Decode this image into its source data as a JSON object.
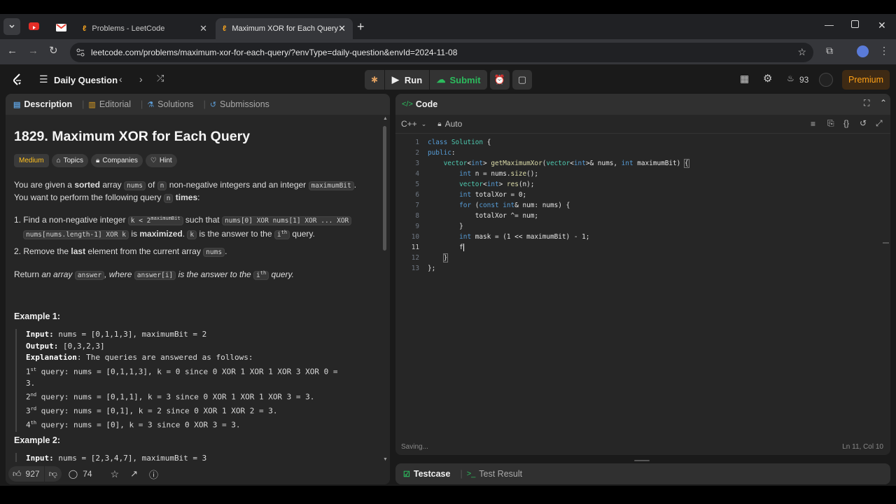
{
  "browser": {
    "tab1_title": "Problems - LeetCode",
    "tab2_title": "Maximum XOR for Each Query",
    "url": "leetcode.com/problems/maximum-xor-for-each-query/?envType=daily-question&envId=2024-11-08"
  },
  "nav": {
    "title": "Daily Question",
    "run": "Run",
    "submit": "Submit",
    "streak": "93",
    "premium": "Premium"
  },
  "left_tabs": {
    "description": "Description",
    "editorial": "Editorial",
    "solutions": "Solutions",
    "submissions": "Submissions"
  },
  "problem": {
    "title": "1829. Maximum XOR for Each Query",
    "difficulty": "Medium",
    "topics": "Topics",
    "companies": "Companies",
    "hint": "Hint",
    "p1": "You are given a",
    "p1b": "sorted",
    "p1c": "array",
    "p1code1": "nums",
    "p1d": "of",
    "p1code2": "n",
    "p1e": "non-negative integers and an integer",
    "p1code3": "maximumBit",
    "p1f": ". You want to perform the following query",
    "p1code4": "n",
    "p1g": "times",
    "li1a": "1. Find a non-negative integer",
    "li1code1": "k < 2",
    "li1sup": "maximumBit",
    "li1b": "such that",
    "li1code2": "nums[0] XOR nums[1] XOR ... XOR",
    "li1code3": "nums[nums.length-1] XOR k",
    "li1c": "is",
    "li1bold": "maximized",
    "li1code4": "k",
    "li1d": "is the answer to the",
    "li1code5": "i",
    "li1sup2": "th",
    "li1e": "query.",
    "li2a": "2. Remove the",
    "li2b": "last",
    "li2c": "element from the current array",
    "li2code": "nums",
    "ret_a": "Return",
    "ret_b": "an array",
    "ret_code": "answer",
    "ret_c": ", where",
    "ret_code2": "answer[i]",
    "ret_d": "is the answer to the",
    "ret_code3": "i",
    "ret_sup": "th",
    "ret_e": "query."
  },
  "example1": {
    "heading": "Example 1:",
    "input_label": "Input:",
    "input": "nums = [0,1,1,3], maximumBit = 2",
    "output_label": "Output:",
    "output": "[0,3,2,3]",
    "expl_label": "Explanation",
    "expl": ": The queries are answered as follows:",
    "q1a": "1",
    "q1s": "st",
    "q1b": " query: nums = [0,1,1,3], k = 0 since 0 XOR 1 XOR 1 XOR 3 XOR 0 =",
    "q1c": "3.",
    "q2a": "2",
    "q2s": "nd",
    "q2b": " query: nums = [0,1,1], k = 3 since 0 XOR 1 XOR 1 XOR 3 = 3.",
    "q3a": "3",
    "q3s": "rd",
    "q3b": " query: nums = [0,1], k = 2 since 0 XOR 1 XOR 2 = 3.",
    "q4a": "4",
    "q4s": "th",
    "q4b": " query: nums = [0], k = 3 since 0 XOR 3 = 3."
  },
  "example2": {
    "heading": "Example 2:",
    "input_label": "Input:",
    "input": "nums = [2,3,4,7], maximumBit = 3"
  },
  "footer": {
    "likes": "927",
    "comments": "74"
  },
  "code": {
    "title": "Code",
    "language": "C++",
    "mode": "Auto",
    "status": "Saving...",
    "cursor": "Ln 11, Col 10",
    "line_numbers": [
      "1",
      "2",
      "3",
      "4",
      "5",
      "6",
      "7",
      "8",
      "9",
      "10",
      "11",
      "12",
      "13"
    ]
  },
  "bottom": {
    "testcase": "Testcase",
    "result": "Test Result"
  },
  "colors": {
    "accent": "#ffa116",
    "green": "#2cbb5d",
    "premium_bg": "#3e2a14"
  }
}
